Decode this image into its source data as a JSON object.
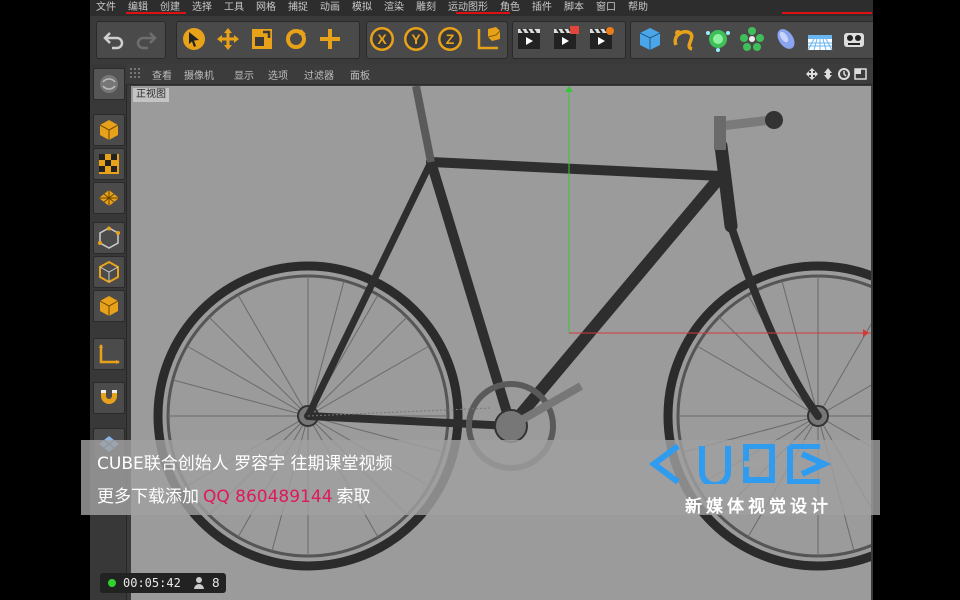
{
  "menu": [
    "文件",
    "编辑",
    "创建",
    "选择",
    "工具",
    "网格",
    "捕捉",
    "动画",
    "模拟",
    "渲染",
    "雕刻",
    "运动图形",
    "角色",
    "插件",
    "脚本",
    "窗口",
    "帮助"
  ],
  "view_menu": [
    "查看",
    "摄像机",
    "显示",
    "选项",
    "过滤器",
    "面板"
  ],
  "viewport_label": "正视图",
  "axis_x_label": "X",
  "axis_y_label": "Y",
  "axis_z_label": "Z",
  "banner": {
    "line1": "CUBE联合创始人 罗容宇 往期课堂视频",
    "line2_prefix": "更多下载添加",
    "qq": "QQ 860489144",
    "line2_suffix": "索取",
    "logo_text": "CUBE",
    "brand": "新媒体视觉设计"
  },
  "status": {
    "time": "00:05:42",
    "viewers": "8"
  },
  "colors": {
    "accent_orange": "#e8a21a",
    "qq_pink": "#e0195a",
    "live_green": "#2fd22f",
    "axis_red": "#d23a3a",
    "axis_green": "#3ac43a"
  },
  "icons": [
    "undo-icon",
    "redo-icon",
    "select-icon",
    "move-icon",
    "scale-icon",
    "rotate-icon",
    "add-icon",
    "x-axis-icon",
    "y-axis-icon",
    "z-axis-icon",
    "coord-icon",
    "render-view-icon",
    "render-pic-icon",
    "render-settings-icon",
    "cube-icon",
    "spline-icon",
    "nurbs-icon",
    "array-icon",
    "deformer-icon",
    "scene-floor-icon",
    "camera-icon"
  ]
}
